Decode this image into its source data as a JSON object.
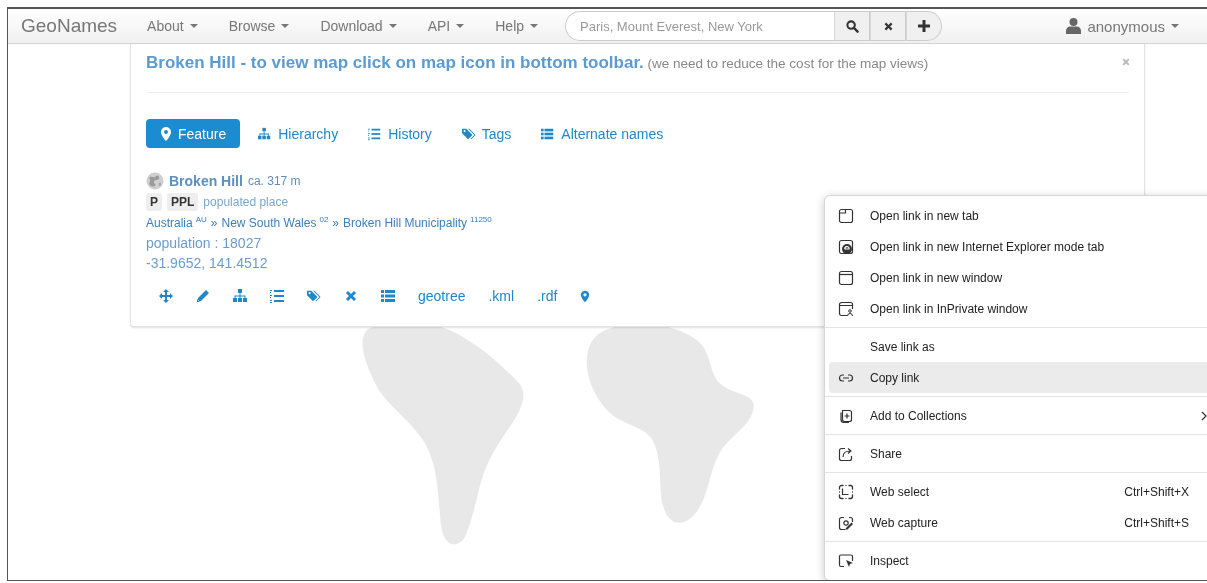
{
  "navbar": {
    "brand": "GeoNames",
    "menus": [
      {
        "label": "About"
      },
      {
        "label": "Browse"
      },
      {
        "label": "Download"
      },
      {
        "label": "API"
      },
      {
        "label": "Help"
      }
    ],
    "search": {
      "placeholder": "Paris, Mount Everest, New York"
    },
    "user": {
      "label": "anonymous"
    }
  },
  "notice": {
    "title": "Broken Hill - to view map click on map icon in bottom toolbar.",
    "note": "(we need to reduce the cost for the map views)"
  },
  "tabs": [
    {
      "label": "Feature",
      "selected": true
    },
    {
      "label": "Hierarchy",
      "selected": false
    },
    {
      "label": "History",
      "selected": false
    },
    {
      "label": "Tags",
      "selected": false
    },
    {
      "label": "Alternate names",
      "selected": false
    }
  ],
  "feature": {
    "name": "Broken Hill",
    "elevation": "ca. 317 m",
    "codes": [
      "P",
      "PPL"
    ],
    "class_label": "populated place",
    "hierarchy": [
      {
        "name": "Australia",
        "code": "AU"
      },
      {
        "name": "New South Wales",
        "code": "02"
      },
      {
        "name": "Broken Hill Municipality",
        "code": "11250"
      }
    ],
    "separator": "»",
    "population": "population : 18027",
    "coordinates": "-31.9652, 141.4512",
    "toolbar_links": [
      "geotree",
      ".kml",
      ".rdf"
    ]
  },
  "context_menu": {
    "sections": [
      [
        {
          "label": "Open link in new tab",
          "selected": false,
          "submenu": false
        },
        {
          "label": "Open link in new Internet Explorer mode tab",
          "selected": false,
          "submenu": false
        },
        {
          "label": "Open link in new window",
          "selected": false,
          "submenu": false
        },
        {
          "label": "Open link in InPrivate window",
          "selected": false,
          "submenu": false
        }
      ],
      [
        {
          "label": "Save link as",
          "selected": false,
          "submenu": false
        },
        {
          "label": "Copy link",
          "selected": true,
          "submenu": false
        }
      ],
      [
        {
          "label": "Add to Collections",
          "selected": false,
          "submenu": true
        }
      ],
      [
        {
          "label": "Share",
          "selected": false,
          "submenu": false
        }
      ],
      [
        {
          "label": "Web select",
          "shortcut": "Ctrl+Shift+X",
          "selected": false,
          "submenu": false
        },
        {
          "label": "Web capture",
          "shortcut": "Ctrl+Shift+S",
          "selected": false,
          "submenu": false
        }
      ],
      [
        {
          "label": "Inspect",
          "selected": false,
          "submenu": false
        }
      ]
    ]
  }
}
